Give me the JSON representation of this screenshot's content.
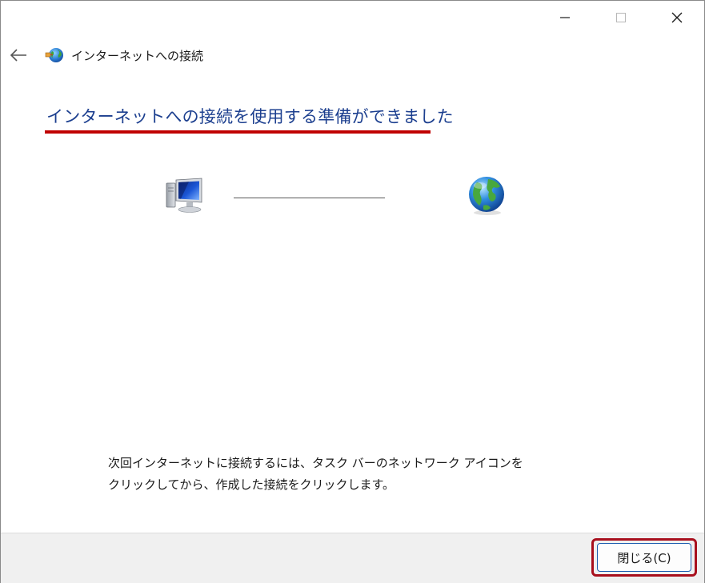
{
  "window": {
    "title": "インターネットへの接続"
  },
  "caption": {
    "minimize_icon": "minimize-icon",
    "maximize_icon": "maximize-icon",
    "close_icon": "close-icon"
  },
  "header": {
    "back_icon": "back-arrow-icon",
    "app_icon": "network-globe-icon",
    "title": "インターネットへの接続"
  },
  "main": {
    "heading": "インターネットへの接続を使用する準備ができました",
    "heading_underline_color": "#c00000",
    "diagram": {
      "left_icon": "computer-icon",
      "right_icon": "globe-icon"
    },
    "info_text": "次回インターネットに接続するには、タスク バーのネットワーク アイコンをクリックしてから、作成した接続をクリックします。"
  },
  "footer": {
    "close_button_label": "閉じる(C)",
    "highlight_color": "#a8101e"
  },
  "colors": {
    "heading": "#1c3f8f",
    "footer_bg": "#f0f0f0",
    "button_border": "#1e5fb0"
  }
}
